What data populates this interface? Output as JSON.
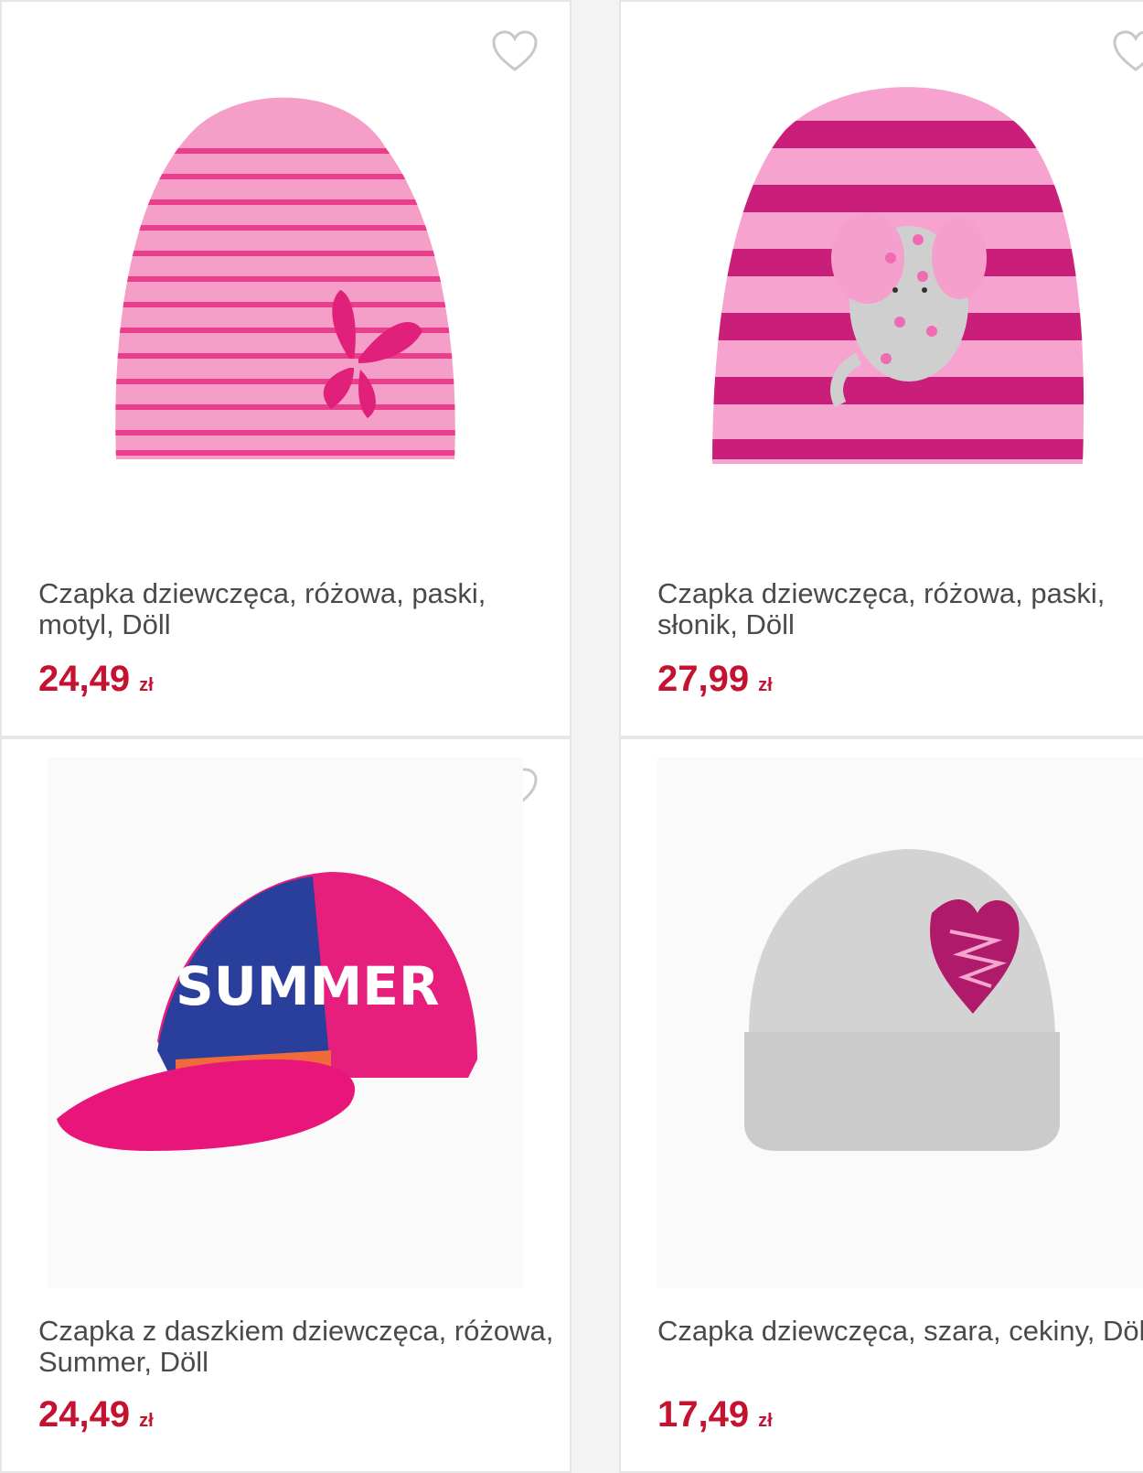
{
  "colors": {
    "price": "#c41230",
    "title": "#4a4a4a",
    "border": "#e6e6e6"
  },
  "products": [
    {
      "title": "Czapka dziewczęca, różowa, paski, motyl, Döll",
      "price": "24,49",
      "currency": "zł",
      "icon": "heart-outline-icon"
    },
    {
      "title": "Czapka dziewczęca, różowa, paski, słonik, Döll",
      "price": "27,99",
      "currency": "zł",
      "icon": "heart-outline-icon"
    },
    {
      "title": "Czapka z daszkiem dziewczęca, różowa, Summer, Döll",
      "price": "24,49",
      "currency": "zł",
      "icon": "heart-outline-icon",
      "print_text": "SUMMER"
    },
    {
      "title": "Czapka dziewczęca, szara, cekiny, Döll",
      "price": "17,49",
      "currency": "zł",
      "icon": "heart-outline-icon"
    }
  ]
}
